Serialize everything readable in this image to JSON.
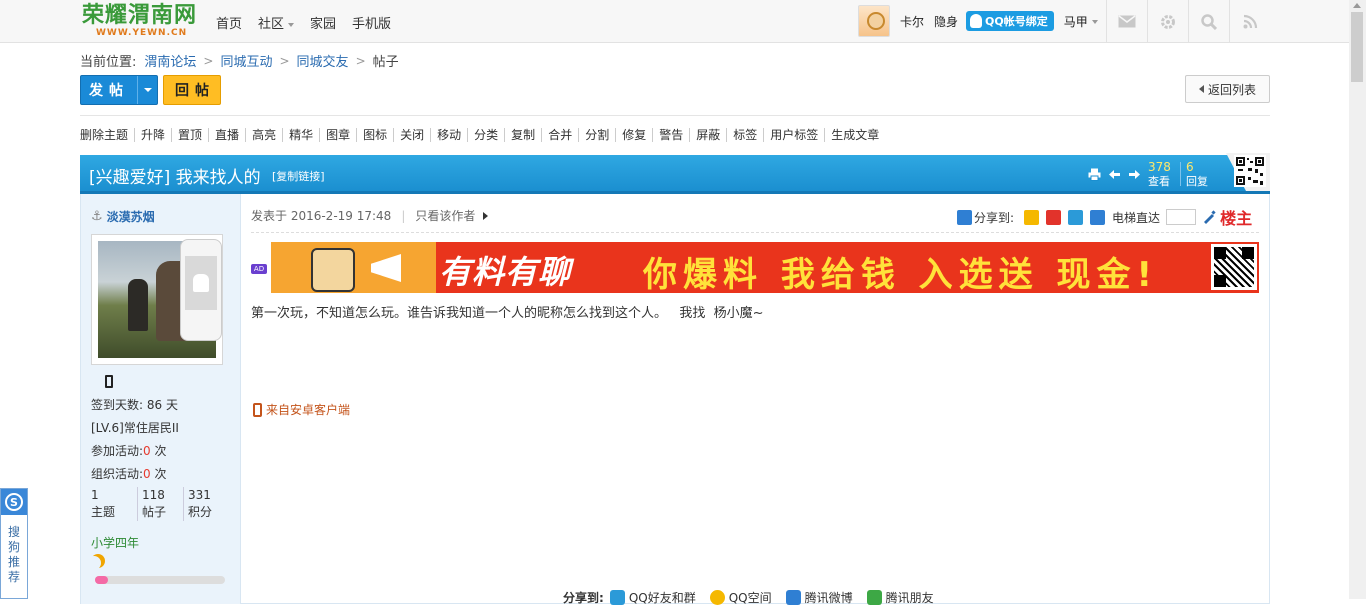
{
  "header": {
    "logo_text": "荣耀渭南网",
    "logo_sub": "WWW.YEWN.CN",
    "nav": [
      "首页",
      "社区",
      "家园",
      "手机版"
    ],
    "username": "卡尔",
    "invisible": "隐身",
    "qq_bind": "QQ帐号绑定",
    "majia": "马甲",
    "icons": [
      "mail-icon",
      "gear-icon",
      "search-icon",
      "rss-icon"
    ]
  },
  "breadcrumb": {
    "label": "当前位置:",
    "items": [
      "渭南论坛",
      "同城互动",
      "同城交友",
      "帖子"
    ]
  },
  "actions": {
    "post": "发帖",
    "reply": "回帖",
    "back": "返回列表"
  },
  "mod_tools": [
    "删除主题",
    "升降",
    "置顶",
    "直播",
    "高亮",
    "精华",
    "图章",
    "图标",
    "关闭",
    "移动",
    "分类",
    "复制",
    "合并",
    "分割",
    "修复",
    "警告",
    "屏蔽",
    "标签",
    "用户标签",
    "生成文章"
  ],
  "thread": {
    "title": "[兴趣爱好] 我来找人的",
    "copy_link": "[复制链接]",
    "views": "378",
    "views_label": "查看",
    "replies": "6",
    "replies_label": "回复"
  },
  "author": {
    "name": "淡漠苏烟",
    "signin": "签到天数: 86 天",
    "level": "[LV.6]常住居民II",
    "activities_joined_label": "参加活动:",
    "activities_joined": "0",
    "activities_org_label": "组织活动:",
    "activities_org": "0",
    "unit": " 次",
    "stats": [
      {
        "value": "1",
        "label": "主题"
      },
      {
        "value": "118",
        "label": "帖子"
      },
      {
        "value": "331",
        "label": "积分"
      }
    ],
    "rank": "小学四年",
    "progress": 0.1
  },
  "post": {
    "meta": "发表于 2016-2-19 17:48",
    "only_author": "只看该作者",
    "share_to": "分享到:",
    "elevator": "电梯直达",
    "louzhu": "楼主",
    "ad_tag": "AD",
    "banner_text1": "有料有聊",
    "banner_text2": "你爆料 我给钱 入选送 现金!",
    "body": "第一次玩，不知道怎么玩。谁告诉我知道一个人的昵称怎么找到这个人。   我找  杨小魔~",
    "from_client": "来自安卓客户端"
  },
  "share_bottom": {
    "label": "分享到:",
    "items": [
      "QQ好友和群",
      "QQ空间",
      "腾讯微博",
      "腾讯朋友"
    ]
  },
  "sogou": {
    "logo": "S",
    "text": "搜狗推荐"
  },
  "colors": {
    "accent_blue": "#1a8ad7",
    "reply_yellow": "#ffbd23",
    "header_bar": "#2fa8e2",
    "sidebar_bg": "#eaf3fb",
    "red": "#e0282a"
  }
}
